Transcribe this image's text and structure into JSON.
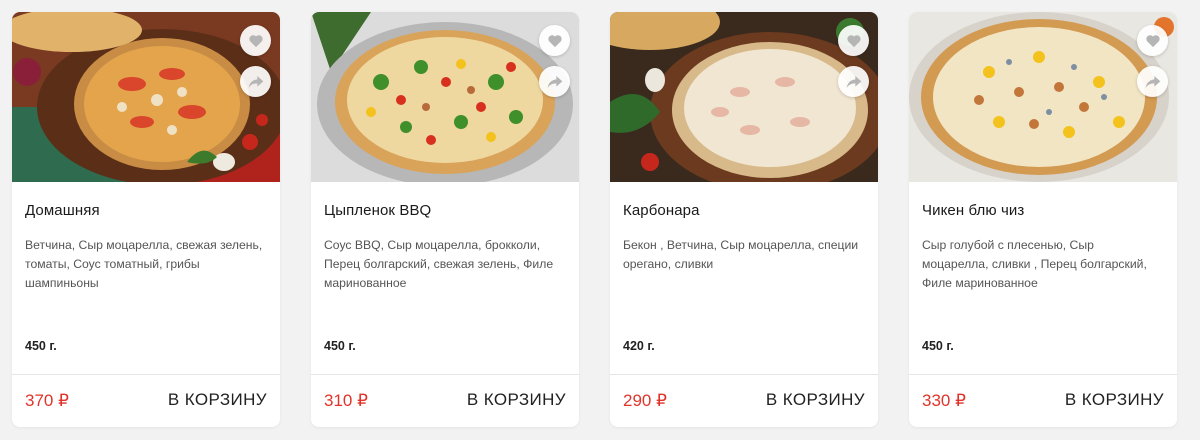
{
  "products": [
    {
      "name": "Домашняя",
      "description": "Ветчина, Сыр моцарелла, свежая зелень, томаты, Соус томатный, грибы шампиньоны",
      "weight": "450 г.",
      "price": "370 ₽",
      "cart_label": "В КОРЗИНУ"
    },
    {
      "name": "Цыпленок BBQ",
      "description": "Соус BBQ, Сыр моцарелла, брокколи, Перец болгарский, свежая зелень, Филе маринованное",
      "weight": "450 г.",
      "price": "310 ₽",
      "cart_label": "В КОРЗИНУ"
    },
    {
      "name": "Карбонара",
      "description": "Бекон , Ветчина, Сыр моцарелла, специи орегано, сливки",
      "weight": "420 г.",
      "price": "290 ₽",
      "cart_label": "В КОРЗИНУ"
    },
    {
      "name": "Чикен блю чиз",
      "description": "Сыр голубой с плесенью, Сыр моцарелла, сливки , Перец болгарский, Филе маринованное",
      "weight": "450 г.",
      "price": "330 ₽",
      "cart_label": "В КОРЗИНУ"
    }
  ],
  "icons": {
    "favorite": "heart-icon",
    "share": "share-icon"
  },
  "colors": {
    "price": "#e0342b",
    "background": "#f2f2f2",
    "card": "#ffffff"
  }
}
